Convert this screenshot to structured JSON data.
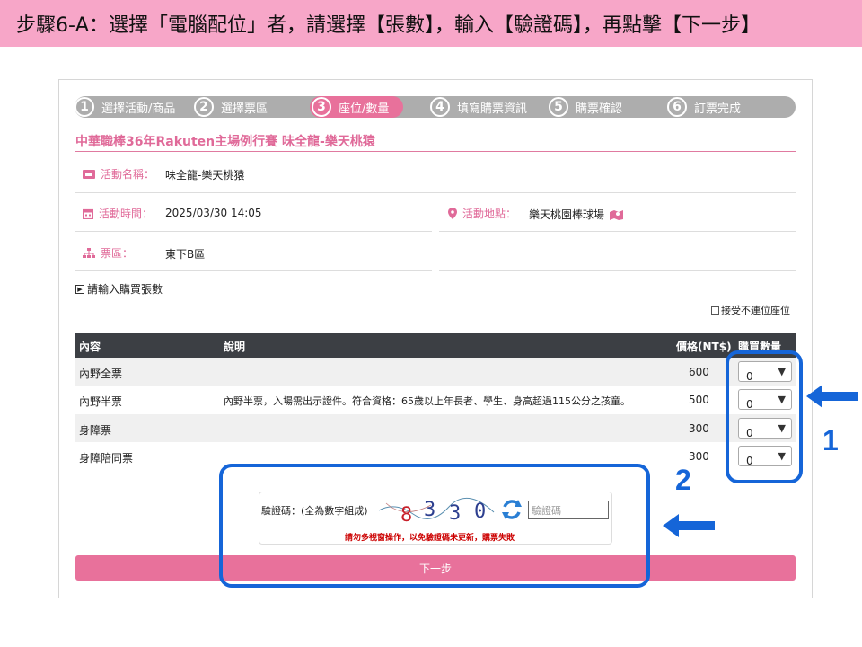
{
  "banner": {
    "text": "步驟6-A：選擇「電腦配位」者，請選擇【張數】，輸入【驗證碼】，再點擊【下一步】"
  },
  "steps": [
    {
      "num": "1",
      "label": "選擇活動/商品"
    },
    {
      "num": "2",
      "label": "選擇票區"
    },
    {
      "num": "3",
      "label": "座位/數量"
    },
    {
      "num": "4",
      "label": "填寫購票資訊"
    },
    {
      "num": "5",
      "label": "購票確認"
    },
    {
      "num": "6",
      "label": "訂票完成"
    }
  ],
  "event": {
    "title": "中華職棒36年Rakuten主場例行賽  味全龍-樂天桃猿",
    "name_label": "活動名稱：",
    "name_value": "味全龍-樂天桃猿",
    "time_label": "活動時間：",
    "time_value": "2025/03/30  14:05",
    "venue_label": "活動地點：",
    "venue_value": "樂天桃園棒球場",
    "area_label": "票區：",
    "area_value": "東下B區"
  },
  "prompt": "請輸入購買張數",
  "accept_nonadjacent": "接受不連位座位",
  "table": {
    "headers": {
      "content": "內容",
      "desc": "說明",
      "price": "價格(NT$)",
      "qty": "購買數量"
    },
    "rows": [
      {
        "content": "內野全票",
        "desc": "",
        "price": "600",
        "qty": "0"
      },
      {
        "content": "內野半票",
        "desc": "內野半票，入場需出示證件。符合資格：65歲以上年長者、學生、身高超過115公分之孩童。",
        "price": "500",
        "qty": "0"
      },
      {
        "content": "身障票",
        "desc": "",
        "price": "300",
        "qty": "0"
      },
      {
        "content": "身障陪同票",
        "desc": "",
        "price": "300",
        "qty": "0"
      }
    ]
  },
  "captcha": {
    "label": "驗證碼：(全為數字組成)",
    "digits": [
      "8",
      "3",
      "3",
      "0"
    ],
    "placeholder": "驗證碼",
    "warning": "請勿多視窗操作，以免驗證碼未更新，購票失敗"
  },
  "next_button": "下一步",
  "annotations": {
    "one": "1",
    "two": "2"
  },
  "colors": {
    "accent": "#e8719b",
    "banner": "#f7a6c8",
    "annotation": "#1565d8",
    "header": "#3c3f44"
  }
}
